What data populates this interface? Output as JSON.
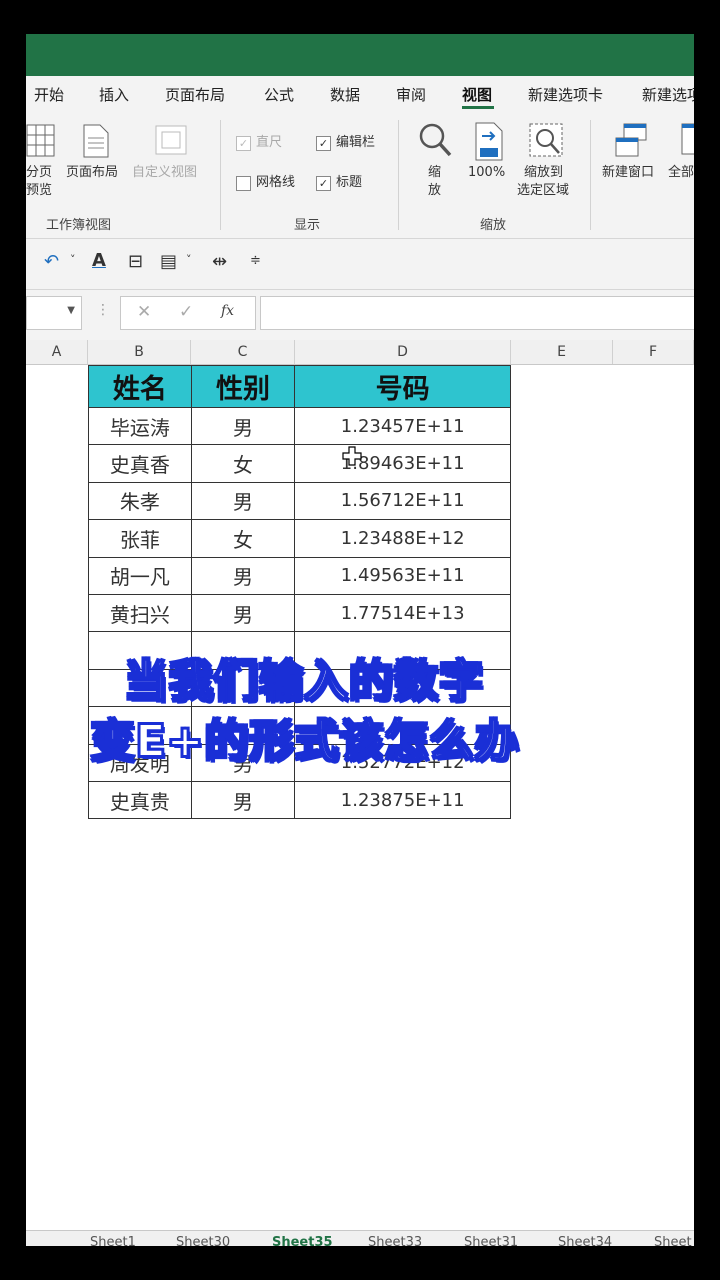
{
  "ribbon": {
    "tabs": [
      "开始",
      "插入",
      "页面布局",
      "公式",
      "数据",
      "审阅",
      "视图",
      "新建选项卡",
      "新建选项"
    ],
    "active_tab": "视图",
    "workbook_views": {
      "page_break_label_1": "分页",
      "page_break_label_2": "预览",
      "page_layout": "页面布局",
      "custom_views": "自定义视图",
      "group": "工作簿视图"
    },
    "show": {
      "ruler": "直尺",
      "formula_bar": "编辑栏",
      "gridlines": "网格线",
      "headings": "标题",
      "group": "显示",
      "check": "✓"
    },
    "zoom": {
      "zoom_1": "缩",
      "zoom_2": "放",
      "hundred": "100%",
      "to_selection_1": "缩放到",
      "to_selection_2": "选定区域",
      "group": "缩放"
    },
    "window": {
      "new_window": "新建窗口",
      "arrange_all": "全部"
    }
  },
  "formula_bar": {
    "cancel": "✕",
    "enter": "✓",
    "fx": "fx",
    "value": ""
  },
  "columns": [
    "A",
    "B",
    "C",
    "D",
    "E",
    "F"
  ],
  "table": {
    "headers": [
      "姓名",
      "性别",
      "号码"
    ],
    "rows": [
      [
        "毕运涛",
        "男",
        "1.23457E+11"
      ],
      [
        "史真香",
        "女",
        "1.89463E+11"
      ],
      [
        "朱孝",
        "男",
        "1.56712E+11"
      ],
      [
        "张菲",
        "女",
        "1.23488E+12"
      ],
      [
        "胡一凡",
        "男",
        "1.49563E+11"
      ],
      [
        "黄扫兴",
        "男",
        "1.77514E+13"
      ],
      [
        "",
        "",
        ""
      ],
      [
        "",
        "",
        ""
      ],
      [
        "",
        "",
        ""
      ],
      [
        "周发明",
        "男",
        "1.52772E+12"
      ],
      [
        "史真贵",
        "男",
        "1.23875E+11"
      ]
    ]
  },
  "overlay": {
    "line1": "当我们输入的数字",
    "line2": "变E+的形式该怎么办"
  },
  "sheets": [
    "Sheet1",
    "Sheet30",
    "Sheet35",
    "Sheet33",
    "Sheet31",
    "Sheet34",
    "Sheet"
  ],
  "colors": {
    "title_bar": "#217346",
    "header_fill": "#2ec4cf",
    "overlay_outline": "#1a2fd6"
  }
}
